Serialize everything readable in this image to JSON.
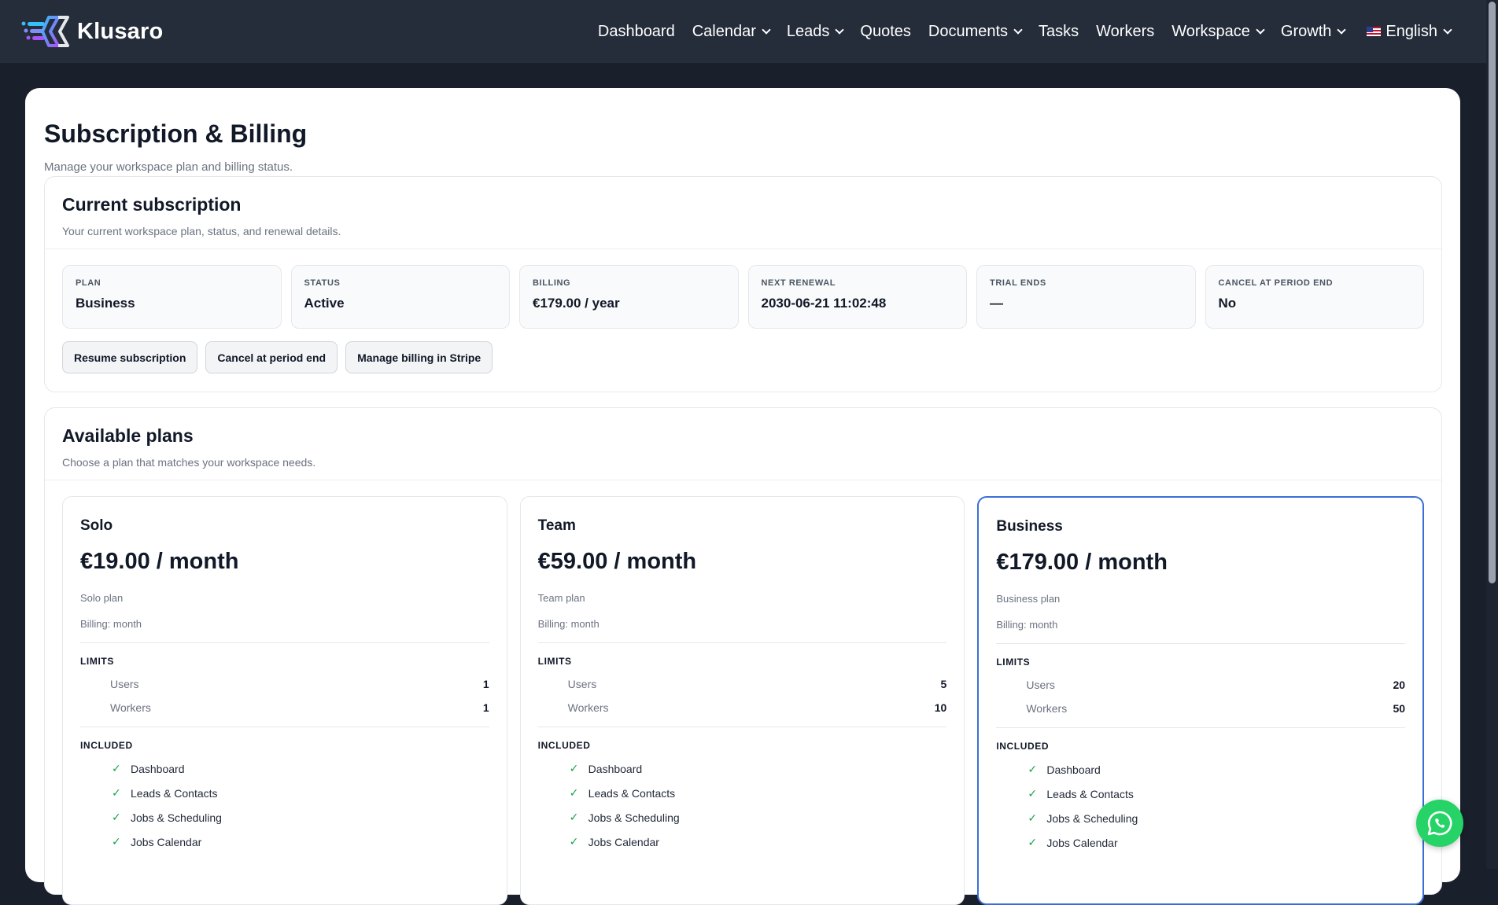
{
  "brand": {
    "name": "Klusaro"
  },
  "nav": [
    {
      "label": "Dashboard",
      "dropdown": false
    },
    {
      "label": "Calendar",
      "dropdown": true
    },
    {
      "label": "Leads",
      "dropdown": true
    },
    {
      "label": "Quotes",
      "dropdown": false
    },
    {
      "label": "Documents",
      "dropdown": true
    },
    {
      "label": "Tasks",
      "dropdown": false
    },
    {
      "label": "Workers",
      "dropdown": false
    },
    {
      "label": "Workspace",
      "dropdown": true
    },
    {
      "label": "Growth",
      "dropdown": true
    }
  ],
  "language": {
    "label": "English",
    "flag": "us-flag-icon"
  },
  "page": {
    "title": "Subscription & Billing",
    "subtitle": "Manage your workspace plan and billing status."
  },
  "current": {
    "title": "Current subscription",
    "subtitle": "Your current workspace plan, status, and renewal details.",
    "stats": [
      {
        "label": "Plan",
        "value": "Business"
      },
      {
        "label": "Status",
        "value": "Active"
      },
      {
        "label": "Billing",
        "value": "€179.00 / year"
      },
      {
        "label": "Next renewal",
        "value": "2030-06-21 11:02:48"
      },
      {
        "label": "Trial ends",
        "value": "—"
      },
      {
        "label": "Cancel at period end",
        "value": "No"
      }
    ],
    "actions": [
      {
        "label": "Resume subscription"
      },
      {
        "label": "Cancel at period end"
      },
      {
        "label": "Manage billing in Stripe"
      }
    ]
  },
  "plans_section": {
    "title": "Available plans",
    "subtitle": "Choose a plan that matches your workspace needs.",
    "limits_label": "LIMITS",
    "included_label": "INCLUDED",
    "plans": [
      {
        "name": "Solo",
        "price": "€19.00 / month",
        "desc": "Solo plan",
        "billing": "Billing: month",
        "current": false,
        "limits": [
          {
            "name": "Users",
            "value": "1"
          },
          {
            "name": "Workers",
            "value": "1"
          }
        ],
        "features": [
          "Dashboard",
          "Leads & Contacts",
          "Jobs & Scheduling",
          "Jobs Calendar"
        ]
      },
      {
        "name": "Team",
        "price": "€59.00 / month",
        "desc": "Team plan",
        "billing": "Billing: month",
        "current": false,
        "limits": [
          {
            "name": "Users",
            "value": "5"
          },
          {
            "name": "Workers",
            "value": "10"
          }
        ],
        "features": [
          "Dashboard",
          "Leads & Contacts",
          "Jobs & Scheduling",
          "Jobs Calendar"
        ]
      },
      {
        "name": "Business",
        "price": "€179.00 / month",
        "desc": "Business plan",
        "billing": "Billing: month",
        "current": true,
        "limits": [
          {
            "name": "Users",
            "value": "20"
          },
          {
            "name": "Workers",
            "value": "50"
          }
        ],
        "features": [
          "Dashboard",
          "Leads & Contacts",
          "Jobs & Scheduling",
          "Jobs Calendar"
        ]
      }
    ]
  },
  "colors": {
    "accent": "#3b6fd6",
    "check": "#16a34a",
    "whatsapp": "#25d366",
    "nav_bg": "#252c3a"
  }
}
